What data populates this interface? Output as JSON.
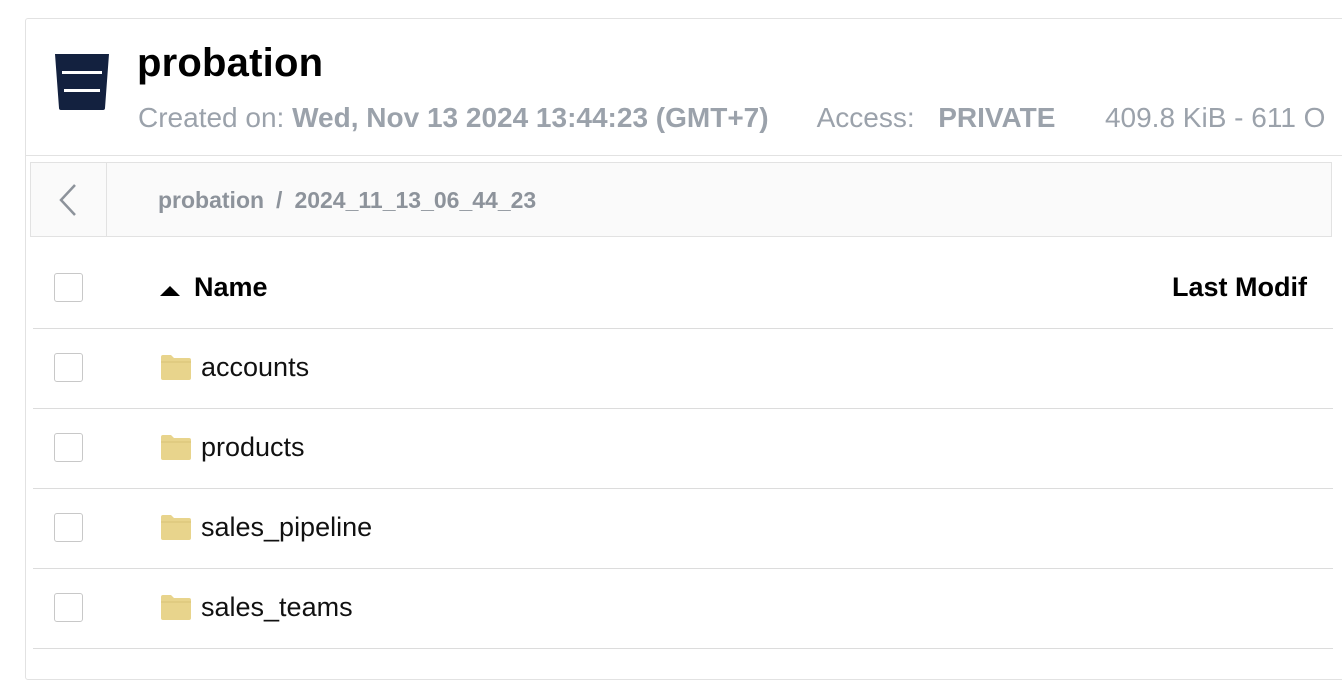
{
  "bucket": {
    "name": "probation",
    "icon": "bucket-icon",
    "created_label": "Created on:",
    "created_value": "Wed, Nov 13 2024 13:44:23 (GMT+7)",
    "access_label": "Access:",
    "access_value": "PRIVATE",
    "usage": "409.8 KiB - 611 O"
  },
  "breadcrumb": {
    "back_icon": "chevron-left-icon",
    "root": "probation",
    "separator": "/",
    "current": "2024_11_13_06_44_23"
  },
  "table": {
    "columns": {
      "name": "Name",
      "last_modified": "Last Modif"
    },
    "sort": {
      "column": "name",
      "direction": "ascending"
    },
    "rows": [
      {
        "name": "accounts",
        "icon": "folder-icon"
      },
      {
        "name": "products",
        "icon": "folder-icon"
      },
      {
        "name": "sales_pipeline",
        "icon": "folder-icon"
      },
      {
        "name": "sales_teams",
        "icon": "folder-icon"
      }
    ]
  },
  "colors": {
    "bucket_icon": "#13213f",
    "folder": "#e8d48c",
    "muted_text": "#9ba2ab"
  }
}
